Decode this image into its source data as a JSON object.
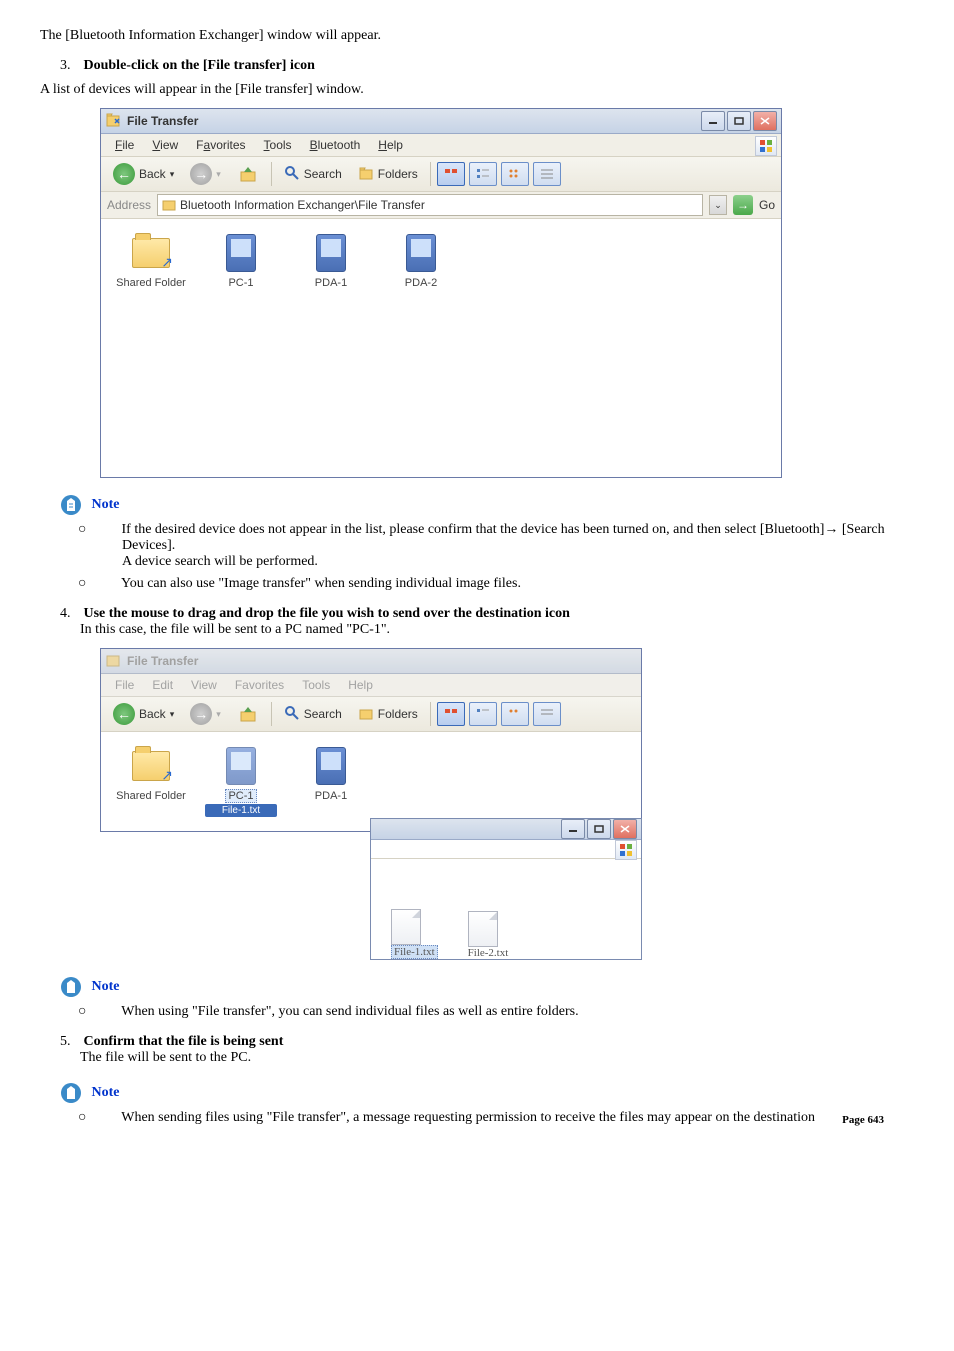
{
  "intro": "The [Bluetooth Information Exchanger] window will appear.",
  "step3": {
    "num": "3.",
    "title": "Double-click on the [File transfer] icon",
    "desc": "A list of devices will appear in the [File transfer] window."
  },
  "window1": {
    "title": "File Transfer",
    "menu": {
      "file": "File",
      "view": "View",
      "favorites": "Favorites",
      "tools": "Tools",
      "bluetooth": "Bluetooth",
      "help": "Help"
    },
    "toolbar": {
      "back": "Back",
      "search": "Search",
      "folders": "Folders"
    },
    "address": {
      "label": "Address",
      "value": "Bluetooth Information Exchanger\\File Transfer",
      "go": "Go"
    },
    "items": {
      "sharedFolder": "Shared Folder",
      "pc1": "PC-1",
      "pda1": "PDA-1",
      "pda2": "PDA-2"
    }
  },
  "note1": {
    "label": "Note",
    "b1a": "If the desired device does not appear in the list, please confirm that the device has been turned on, and then select [Bluetooth]→ [Search Devices].",
    "b1b": "A device search will be performed.",
    "b2": "You can also use \"Image transfer\" when sending individual image files."
  },
  "step4": {
    "num": "4.",
    "title": "Use the mouse to drag and drop the file you wish to send over the destination icon",
    "desc": "In this case, the file will be sent to a PC named \"PC-1\"."
  },
  "window2": {
    "title": "File Transfer",
    "menu": {
      "file": "File",
      "edit": "Edit",
      "view": "View",
      "favorites": "Favorites",
      "tools": "Tools",
      "help": "Help"
    },
    "toolbar": {
      "back": "Back",
      "search": "Search",
      "folders": "Folders"
    },
    "items": {
      "sharedFolder": "Shared Folder",
      "pc1": "PC-1",
      "pda1": "PDA-1",
      "dragLabel": "File-1.txt"
    },
    "files": {
      "f1": "File-1.txt",
      "f2": "File-2.txt"
    }
  },
  "note2": {
    "label": "Note",
    "b1": "When using \"File transfer\", you can send individual files as well as entire folders."
  },
  "step5": {
    "num": "5.",
    "title": "Confirm that the file is being sent",
    "desc": "The file will be sent to the PC."
  },
  "note3": {
    "label": "Note",
    "b1": "When sending files using \"File transfer\", a message requesting permission to receive the files may appear on the destination"
  },
  "pageNum": "Page 643"
}
